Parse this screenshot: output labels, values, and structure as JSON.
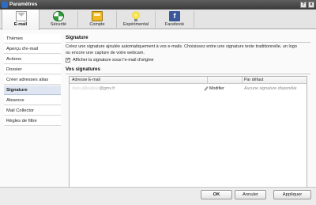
{
  "window": {
    "title": "Paramètres",
    "help_label": "?",
    "close_label": "x"
  },
  "tabs": [
    {
      "label": "E-mail",
      "icon": "envelope-icon",
      "active": true
    },
    {
      "label": "Sécurité",
      "icon": "shield-icon"
    },
    {
      "label": "Compte",
      "icon": "calculator-icon"
    },
    {
      "label": "Expérimental",
      "icon": "lightbulb-icon"
    },
    {
      "label": "Facebook",
      "icon": "facebook-icon",
      "glyph": "f"
    }
  ],
  "sidebar": {
    "items": [
      {
        "label": "Thèmes"
      },
      {
        "label": "Aperçu d'e-mail"
      },
      {
        "label": "Actions"
      },
      {
        "label": "Dossier"
      },
      {
        "label": "Créer adresses alias"
      },
      {
        "label": "Signature",
        "active": true
      },
      {
        "label": "Absence"
      },
      {
        "label": "Mail Collector"
      },
      {
        "label": "Règles de filtre"
      }
    ]
  },
  "signature": {
    "title": "Signature",
    "description": "Créez une signature ajoutée automatiquement à vos e-mails. Choisissez entre une signature texte traditionnelle, un logo ou encore une capture de votre webcam.",
    "checkbox_label": "Afficher la signature sous l'e-mail d'origine",
    "checkbox_checked": true,
    "checkbox_mark": "✓"
  },
  "signatures_table": {
    "title": "Vos signatures",
    "columns": [
      "Adresse E-mail",
      "",
      "Par défaut"
    ],
    "rows": [
      {
        "email_hidden": "mon.utilisateur",
        "email_domain": "@gmx.fr",
        "action": "Modifier",
        "default": "Aucune signature disponible"
      }
    ]
  },
  "footer": {
    "ok_label": "OK",
    "cancel_label": "Annuler",
    "apply_label": "Appliquer"
  },
  "colors": {
    "active_sidebar": "#dfe6f1",
    "titlebar": "#4a4a4a",
    "facebook": "#3b5998"
  }
}
